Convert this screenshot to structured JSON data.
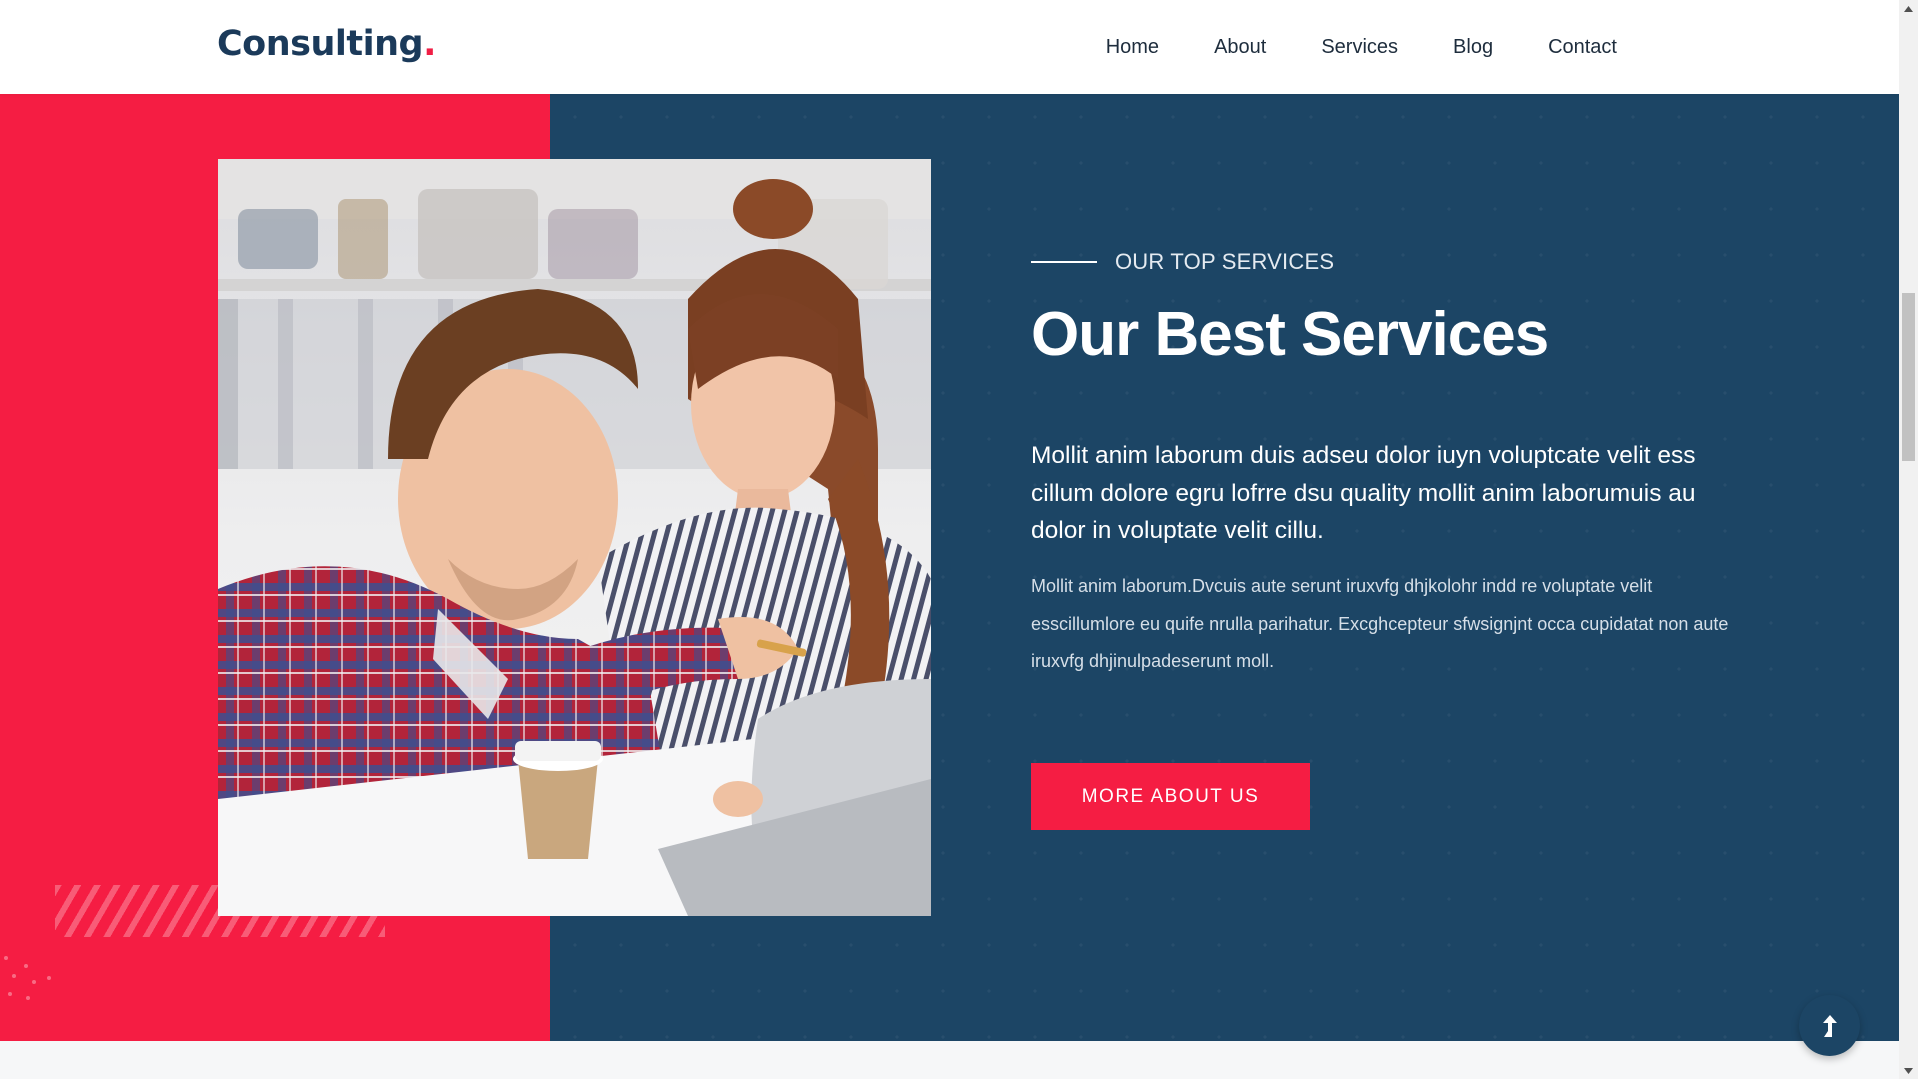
{
  "header": {
    "logo_text": "Consulting",
    "logo_dot": ".",
    "nav": [
      "Home",
      "About",
      "Services",
      "Blog",
      "Contact"
    ]
  },
  "services": {
    "eyebrow": "OUR TOP SERVICES",
    "title": "Our Best Services",
    "lead": "Mollit anim laborum duis adseu dolor iuyn voluptcate velit ess cillum dolore egru lofrre dsu quality mollit anim laborumuis au dolor in voluptate velit cillu.",
    "body": "Mollit anim laborum.Dvcuis aute serunt iruxvfg dhjkolohr indd re voluptate velit esscillumlore eu quife nrulla parihatur. Excghcepteur sfwsignjnt occa cupidatat non aute iruxvfg dhjinulpadeserunt moll.",
    "cta_label": "MORE ABOUT US"
  },
  "icons": {
    "back_to_top": "arrow-up-icon",
    "scroll_up": "triangle-up-icon",
    "scroll_down": "triangle-down-icon"
  },
  "colors": {
    "accent_red": "#f51d43",
    "navy": "#1c4565",
    "logo_text": "#1b3a5a"
  }
}
